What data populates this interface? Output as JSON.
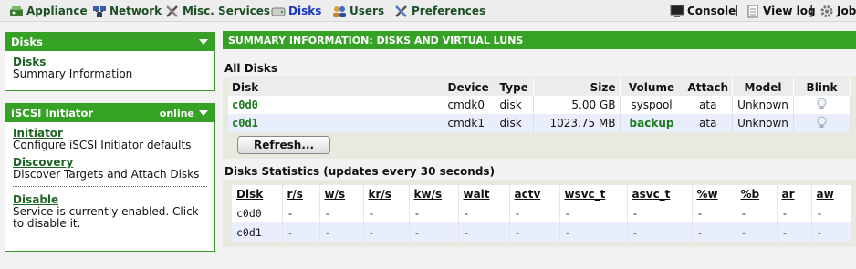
{
  "nav": {
    "appliance": "Appliance",
    "network": "Network",
    "misc_services": "Misc. Services",
    "disks": "Disks",
    "users": "Users",
    "preferences": "Preferences",
    "console": "Console",
    "view_log": "View log",
    "jobs": "Jobs"
  },
  "sidebar": {
    "disks_panel": {
      "title": "Disks",
      "link": "Disks",
      "desc": "Summary Information"
    },
    "iscsi_panel": {
      "title": "iSCSI Initiator",
      "status": "online",
      "initiator_link": "Initiator",
      "initiator_desc": "Configure iSCSI Initiator defaults",
      "discovery_link": "Discovery",
      "discovery_desc": "Discover Targets and Attach Disks",
      "disable_link": "Disable",
      "disable_desc": "Service is currently enabled. Click to disable it."
    }
  },
  "main": {
    "header": "SUMMARY INFORMATION: DISKS AND VIRTUAL LUNS",
    "all_disks_title": "All Disks",
    "disk_columns": [
      "Disk",
      "Device",
      "Type",
      "Size",
      "Volume",
      "Attach",
      "Model",
      "Blink"
    ],
    "disks": [
      {
        "disk": "c0d0",
        "device": "cmdk0",
        "type": "disk",
        "size": "5.00 GB",
        "volume": "syspool",
        "attach": "ata",
        "model": "Unknown"
      },
      {
        "disk": "c0d1",
        "device": "cmdk1",
        "type": "disk",
        "size": "1023.75 MB",
        "volume": "backup",
        "attach": "ata",
        "model": "Unknown"
      }
    ],
    "refresh_label": "Refresh...",
    "stats_title": "Disks Statistics (updates every 30 seconds)",
    "stats_columns": [
      "Disk",
      "r/s",
      "w/s",
      "kr/s",
      "kw/s",
      "wait",
      "actv",
      "wsvc_t",
      "asvc_t",
      "%w",
      "%b",
      "ar",
      "aw"
    ],
    "stats_rows": [
      [
        "c0d0",
        "-",
        "-",
        "-",
        "-",
        "-",
        "-",
        "-",
        "-",
        "-",
        "-",
        "-",
        "-"
      ],
      [
        "c0d1",
        "-",
        "-",
        "-",
        "-",
        "-",
        "-",
        "-",
        "-",
        "-",
        "-",
        "-",
        "-"
      ]
    ]
  },
  "colors": {
    "accent_green": "#35a125",
    "link_green": "#1e7a1e",
    "active_nav": "#1a37c6"
  }
}
